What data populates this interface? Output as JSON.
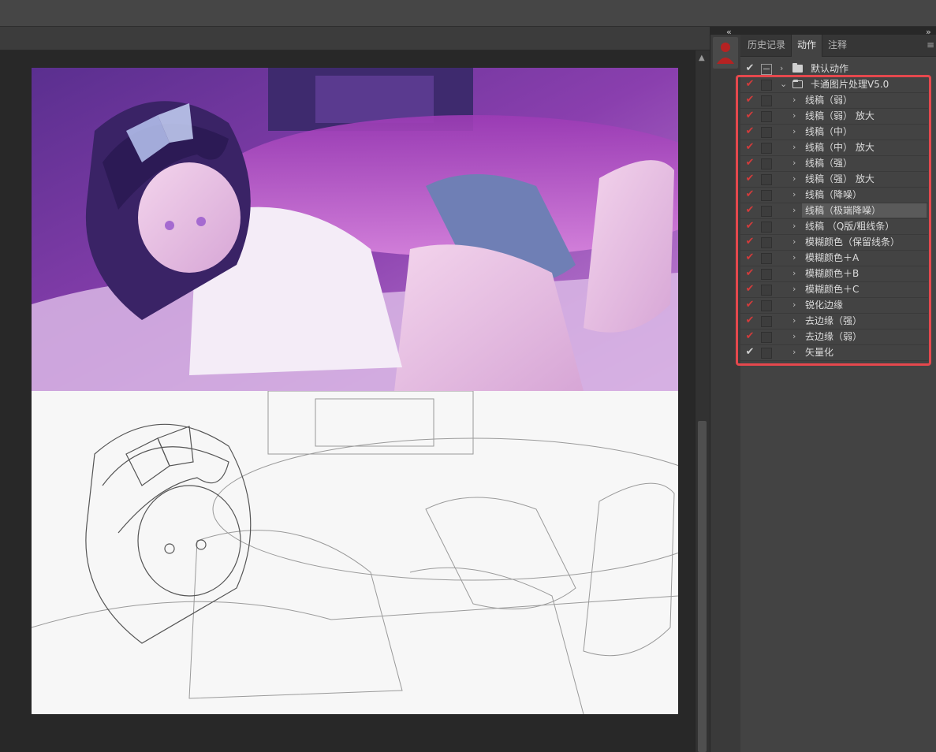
{
  "panel": {
    "tabs": [
      {
        "label": "历史记录",
        "active": false
      },
      {
        "label": "动作",
        "active": true
      },
      {
        "label": "注释",
        "active": false
      }
    ],
    "collapse_left": "‹‹",
    "collapse_right": "››",
    "menu_icon": "≡",
    "actions": [
      {
        "label": "默认动作",
        "type": "set",
        "check": "white",
        "dialog": true,
        "expanded": false
      },
      {
        "label": "卡通图片处理V5.0",
        "type": "set",
        "check": "red",
        "dialog": false,
        "expanded": true
      },
      {
        "label": "线稿（弱）",
        "type": "action",
        "check": "red"
      },
      {
        "label": "线稿（弱） 放大",
        "type": "action",
        "check": "red"
      },
      {
        "label": "线稿（中）",
        "type": "action",
        "check": "red"
      },
      {
        "label": "线稿（中）  放大",
        "type": "action",
        "check": "red"
      },
      {
        "label": "线稿（强）",
        "type": "action",
        "check": "red"
      },
      {
        "label": "线稿（强） 放大",
        "type": "action",
        "check": "red"
      },
      {
        "label": "线稿（降噪）",
        "type": "action",
        "check": "red"
      },
      {
        "label": "线稿（极端降噪）",
        "type": "action",
        "check": "red",
        "selected": true
      },
      {
        "label": "线稿 （Q版/粗线条）",
        "type": "action",
        "check": "red"
      },
      {
        "label": "模糊颜色（保留线条）",
        "type": "action",
        "check": "red"
      },
      {
        "label": "模糊颜色＋A",
        "type": "action",
        "check": "red"
      },
      {
        "label": "模糊颜色＋B",
        "type": "action",
        "check": "red"
      },
      {
        "label": "模糊颜色＋C",
        "type": "action",
        "check": "red"
      },
      {
        "label": "锐化边缘",
        "type": "action",
        "check": "red"
      },
      {
        "label": "去边缘（强）",
        "type": "action",
        "check": "red"
      },
      {
        "label": "去边缘（弱）",
        "type": "action",
        "check": "red"
      },
      {
        "label": "矢量化",
        "type": "action",
        "check": "white"
      }
    ]
  },
  "colors": {
    "accent_highlight": "#e5484d",
    "check_red": "#d23b3b",
    "panel_bg": "#434343",
    "canvas_bg": "#282828"
  }
}
